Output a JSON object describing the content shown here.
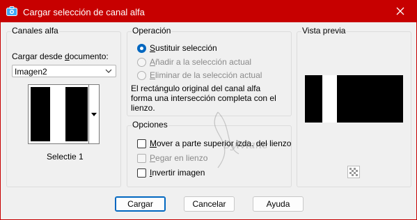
{
  "window": {
    "title": "Cargar selección de canal alfa",
    "close_label": "close"
  },
  "canales": {
    "group_label": "Canales alfa",
    "load_from_label": "Cargar desde documento:",
    "load_from_underline": "d",
    "document_value": "Imagen2",
    "channel_name": "Selectie 1"
  },
  "operacion": {
    "group_label": "Operación",
    "options": [
      {
        "label": "Sustituir selección",
        "checked": true,
        "enabled": true
      },
      {
        "label": "Añadir a la selección actual",
        "checked": false,
        "enabled": false
      },
      {
        "label": "Eliminar de la selección actual",
        "checked": false,
        "enabled": false
      }
    ],
    "description": "El rectángulo original del canal alfa forma una intersección completa con el lienzo."
  },
  "opciones": {
    "group_label": "Opciones",
    "checks": [
      {
        "label": "Mover a parte superior izda. del lienzo",
        "checked": false,
        "enabled": true
      },
      {
        "label": "Pegar en lienzo",
        "checked": false,
        "enabled": false
      },
      {
        "label": "Invertir imagen",
        "checked": false,
        "enabled": true
      }
    ]
  },
  "preview": {
    "group_label": "Vista previa"
  },
  "buttons": {
    "ok": "Cargar",
    "cancel": "Cancelar",
    "help": "Ayuda"
  },
  "watermark_text": "Sylviane",
  "colors": {
    "titlebar": "#c70000",
    "accent": "#0067c0"
  }
}
